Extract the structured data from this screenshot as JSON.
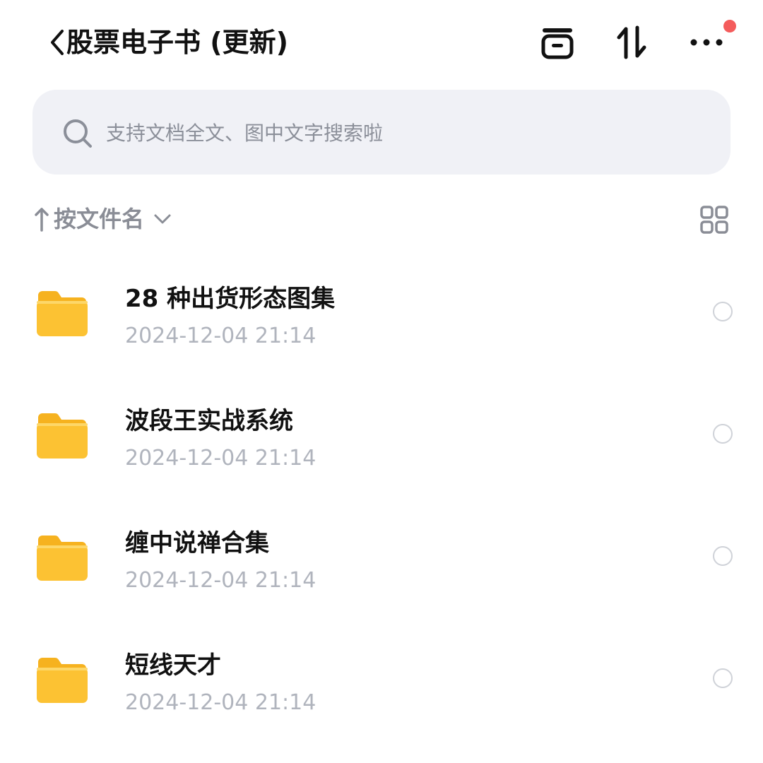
{
  "header": {
    "title": "股票电子书 (更新)",
    "icons": [
      "back-icon",
      "archive-icon",
      "sort-icon",
      "more-icon"
    ],
    "notification_dot_color": "#f45c5c"
  },
  "search": {
    "placeholder": "支持文档全文、图中文字搜索啦"
  },
  "sort": {
    "label": "按文件名"
  },
  "folders": [
    {
      "name": "28 种出货形态图集",
      "date": "2024-12-04 21:14"
    },
    {
      "name": "波段王实战系统",
      "date": "2024-12-04 21:14"
    },
    {
      "name": "缠中说禅合集",
      "date": "2024-12-04 21:14"
    },
    {
      "name": "短线天才",
      "date": "2024-12-04 21:14"
    }
  ],
  "colors": {
    "folder": "#fcc233",
    "folder_tab": "#f6b21f",
    "search_bg": "#f0f1f6",
    "secondary_text": "#b0b4bd"
  }
}
